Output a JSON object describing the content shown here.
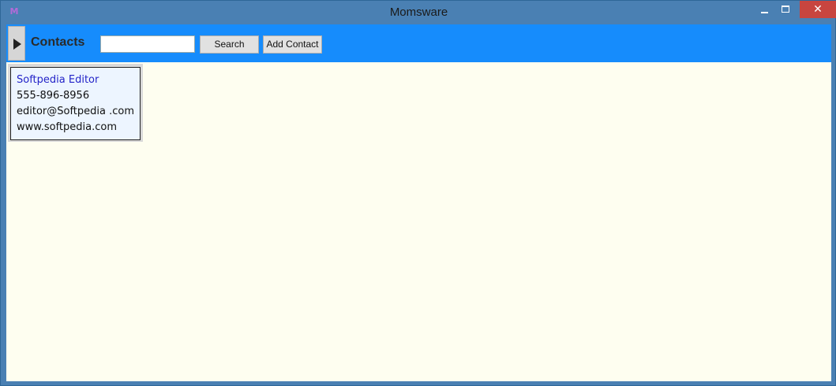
{
  "window": {
    "title": "Momsware",
    "app_icon_glyph": "M",
    "controls": {
      "close_glyph": "✕"
    }
  },
  "toolbar": {
    "title": "Contacts",
    "search_value": "",
    "search_label": "Search",
    "add_contact_label": "Add Contact"
  },
  "contacts": [
    {
      "name": "Softpedia Editor",
      "phone": "555-896-8956",
      "email": "editor@Softpedia .com",
      "website": "www.softpedia.com"
    }
  ],
  "colors": {
    "toolbar_bg": "#168cfc",
    "content_bg": "#fefef0",
    "card_bg": "#edf5ff",
    "contact_name": "#2424c8",
    "titlebar": "#4a80b3",
    "close_button": "#c8453f"
  }
}
